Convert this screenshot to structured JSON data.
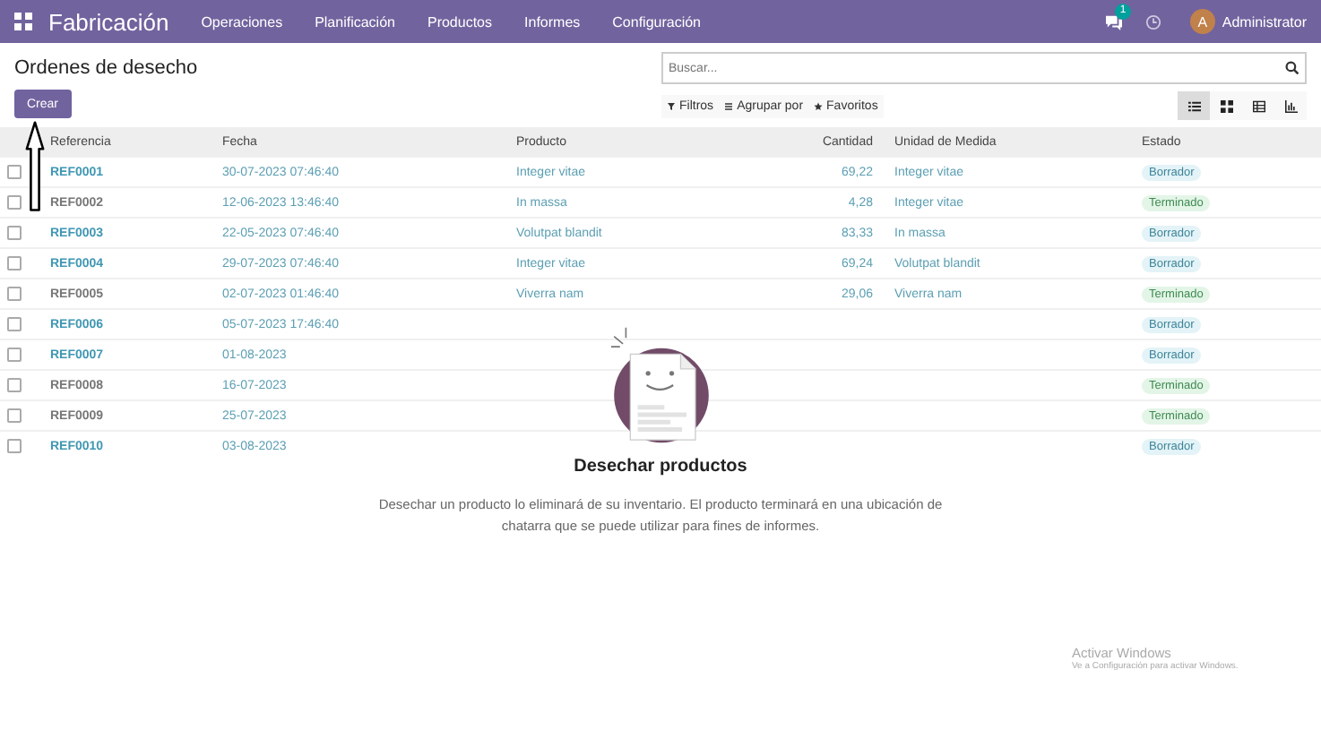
{
  "navbar": {
    "app_name": "Fabricación",
    "menu": [
      "Operaciones",
      "Planificación",
      "Productos",
      "Informes",
      "Configuración"
    ],
    "messages_count": "1",
    "user_initial": "A",
    "user_name": "Administrator"
  },
  "control_panel": {
    "title": "Ordenes de desecho",
    "create_button": "Crear",
    "search": {
      "placeholder": "Buscar..."
    },
    "filters": [
      "Filtros",
      "Agrupar por",
      "Favoritos"
    ],
    "views": [
      {
        "kind": "list",
        "selected": true
      },
      {
        "kind": "kanban",
        "selected": false
      },
      {
        "kind": "pivot",
        "selected": false
      },
      {
        "kind": "graph",
        "selected": false
      }
    ]
  },
  "table": {
    "columns": [
      "Referencia",
      "Fecha",
      "Producto",
      "Cantidad",
      "Unidad de Medida",
      "Estado"
    ],
    "rows": [
      {
        "checked": false,
        "reference": "REF0001",
        "date": "30-07-2023 07:46:40",
        "product": "Integer vitae",
        "quantity": "69,22",
        "unit": "Integer vitae",
        "status": {
          "label": "Borrador",
          "kind": "draft"
        }
      },
      {
        "checked": false,
        "reference": "REF0002",
        "date": "12-06-2023 13:46:40",
        "product": "In massa",
        "quantity": "4,28",
        "unit": "Integer vitae",
        "status": {
          "label": "Terminado",
          "kind": "done"
        }
      },
      {
        "checked": false,
        "reference": "REF0003",
        "date": "22-05-2023 07:46:40",
        "product": "Volutpat blandit",
        "quantity": "83,33",
        "unit": "In massa",
        "status": {
          "label": "Borrador",
          "kind": "draft"
        }
      },
      {
        "checked": false,
        "reference": "REF0004",
        "date": "29-07-2023 07:46:40",
        "product": "Integer vitae",
        "quantity": "69,24",
        "unit": "Volutpat blandit",
        "status": {
          "label": "Borrador",
          "kind": "draft"
        }
      },
      {
        "checked": false,
        "reference": "REF0005",
        "date": "02-07-2023 01:46:40",
        "product": "Viverra nam",
        "quantity": "29,06",
        "unit": "Viverra nam",
        "status": {
          "label": "Terminado",
          "kind": "done"
        }
      },
      {
        "checked": false,
        "reference": "REF0006",
        "date": "05-07-2023 17:46:40",
        "status": {
          "label": "Borrador",
          "kind": "draft"
        }
      },
      {
        "checked": false,
        "reference": "REF0007",
        "date": "01-08-2023",
        "status": {
          "label": "Borrador",
          "kind": "draft"
        }
      },
      {
        "checked": false,
        "reference": "REF0008",
        "date": "16-07-2023",
        "status": {
          "label": "Terminado",
          "kind": "done"
        }
      },
      {
        "checked": false,
        "reference": "REF0009",
        "date": "25-07-2023",
        "status": {
          "label": "Terminado",
          "kind": "done"
        }
      },
      {
        "checked": false,
        "reference": "REF0010",
        "date": "03-08-2023",
        "status": {
          "label": "Borrador",
          "kind": "draft"
        }
      }
    ]
  },
  "empty_state": {
    "title": "Desechar productos",
    "text": "Desechar un producto lo eliminará de su inventario. El producto terminará en una ubicación de chatarra que se puede utilizar para fines de informes."
  },
  "os_notice": {
    "title": "Activar Windows",
    "text": "Ve a Configuración para activar Windows."
  }
}
